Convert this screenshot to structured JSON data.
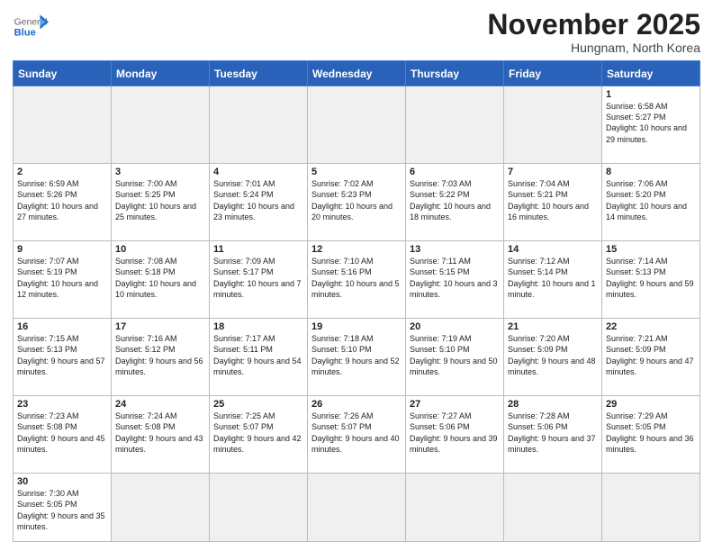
{
  "header": {
    "logo_general": "General",
    "logo_blue": "Blue",
    "month_title": "November 2025",
    "subtitle": "Hungnam, North Korea"
  },
  "weekdays": [
    "Sunday",
    "Monday",
    "Tuesday",
    "Wednesday",
    "Thursday",
    "Friday",
    "Saturday"
  ],
  "days": [
    {
      "num": "",
      "info": "",
      "empty": true
    },
    {
      "num": "",
      "info": "",
      "empty": true
    },
    {
      "num": "",
      "info": "",
      "empty": true
    },
    {
      "num": "",
      "info": "",
      "empty": true
    },
    {
      "num": "",
      "info": "",
      "empty": true
    },
    {
      "num": "",
      "info": "",
      "empty": true
    },
    {
      "num": "1",
      "info": "Sunrise: 6:58 AM\nSunset: 5:27 PM\nDaylight: 10 hours\nand 29 minutes."
    },
    {
      "num": "2",
      "info": "Sunrise: 6:59 AM\nSunset: 5:26 PM\nDaylight: 10 hours\nand 27 minutes."
    },
    {
      "num": "3",
      "info": "Sunrise: 7:00 AM\nSunset: 5:25 PM\nDaylight: 10 hours\nand 25 minutes."
    },
    {
      "num": "4",
      "info": "Sunrise: 7:01 AM\nSunset: 5:24 PM\nDaylight: 10 hours\nand 23 minutes."
    },
    {
      "num": "5",
      "info": "Sunrise: 7:02 AM\nSunset: 5:23 PM\nDaylight: 10 hours\nand 20 minutes."
    },
    {
      "num": "6",
      "info": "Sunrise: 7:03 AM\nSunset: 5:22 PM\nDaylight: 10 hours\nand 18 minutes."
    },
    {
      "num": "7",
      "info": "Sunrise: 7:04 AM\nSunset: 5:21 PM\nDaylight: 10 hours\nand 16 minutes."
    },
    {
      "num": "8",
      "info": "Sunrise: 7:06 AM\nSunset: 5:20 PM\nDaylight: 10 hours\nand 14 minutes."
    },
    {
      "num": "9",
      "info": "Sunrise: 7:07 AM\nSunset: 5:19 PM\nDaylight: 10 hours\nand 12 minutes."
    },
    {
      "num": "10",
      "info": "Sunrise: 7:08 AM\nSunset: 5:18 PM\nDaylight: 10 hours\nand 10 minutes."
    },
    {
      "num": "11",
      "info": "Sunrise: 7:09 AM\nSunset: 5:17 PM\nDaylight: 10 hours\nand 7 minutes."
    },
    {
      "num": "12",
      "info": "Sunrise: 7:10 AM\nSunset: 5:16 PM\nDaylight: 10 hours\nand 5 minutes."
    },
    {
      "num": "13",
      "info": "Sunrise: 7:11 AM\nSunset: 5:15 PM\nDaylight: 10 hours\nand 3 minutes."
    },
    {
      "num": "14",
      "info": "Sunrise: 7:12 AM\nSunset: 5:14 PM\nDaylight: 10 hours\nand 1 minute."
    },
    {
      "num": "15",
      "info": "Sunrise: 7:14 AM\nSunset: 5:13 PM\nDaylight: 9 hours\nand 59 minutes."
    },
    {
      "num": "16",
      "info": "Sunrise: 7:15 AM\nSunset: 5:13 PM\nDaylight: 9 hours\nand 57 minutes."
    },
    {
      "num": "17",
      "info": "Sunrise: 7:16 AM\nSunset: 5:12 PM\nDaylight: 9 hours\nand 56 minutes."
    },
    {
      "num": "18",
      "info": "Sunrise: 7:17 AM\nSunset: 5:11 PM\nDaylight: 9 hours\nand 54 minutes."
    },
    {
      "num": "19",
      "info": "Sunrise: 7:18 AM\nSunset: 5:10 PM\nDaylight: 9 hours\nand 52 minutes."
    },
    {
      "num": "20",
      "info": "Sunrise: 7:19 AM\nSunset: 5:10 PM\nDaylight: 9 hours\nand 50 minutes."
    },
    {
      "num": "21",
      "info": "Sunrise: 7:20 AM\nSunset: 5:09 PM\nDaylight: 9 hours\nand 48 minutes."
    },
    {
      "num": "22",
      "info": "Sunrise: 7:21 AM\nSunset: 5:09 PM\nDaylight: 9 hours\nand 47 minutes."
    },
    {
      "num": "23",
      "info": "Sunrise: 7:23 AM\nSunset: 5:08 PM\nDaylight: 9 hours\nand 45 minutes."
    },
    {
      "num": "24",
      "info": "Sunrise: 7:24 AM\nSunset: 5:08 PM\nDaylight: 9 hours\nand 43 minutes."
    },
    {
      "num": "25",
      "info": "Sunrise: 7:25 AM\nSunset: 5:07 PM\nDaylight: 9 hours\nand 42 minutes."
    },
    {
      "num": "26",
      "info": "Sunrise: 7:26 AM\nSunset: 5:07 PM\nDaylight: 9 hours\nand 40 minutes."
    },
    {
      "num": "27",
      "info": "Sunrise: 7:27 AM\nSunset: 5:06 PM\nDaylight: 9 hours\nand 39 minutes."
    },
    {
      "num": "28",
      "info": "Sunrise: 7:28 AM\nSunset: 5:06 PM\nDaylight: 9 hours\nand 37 minutes."
    },
    {
      "num": "29",
      "info": "Sunrise: 7:29 AM\nSunset: 5:05 PM\nDaylight: 9 hours\nand 36 minutes."
    },
    {
      "num": "30",
      "info": "Sunrise: 7:30 AM\nSunset: 5:05 PM\nDaylight: 9 hours\nand 35 minutes."
    },
    {
      "num": "",
      "info": "",
      "empty": true
    },
    {
      "num": "",
      "info": "",
      "empty": true
    },
    {
      "num": "",
      "info": "",
      "empty": true
    },
    {
      "num": "",
      "info": "",
      "empty": true
    },
    {
      "num": "",
      "info": "",
      "empty": true
    },
    {
      "num": "",
      "info": "",
      "empty": true
    }
  ]
}
